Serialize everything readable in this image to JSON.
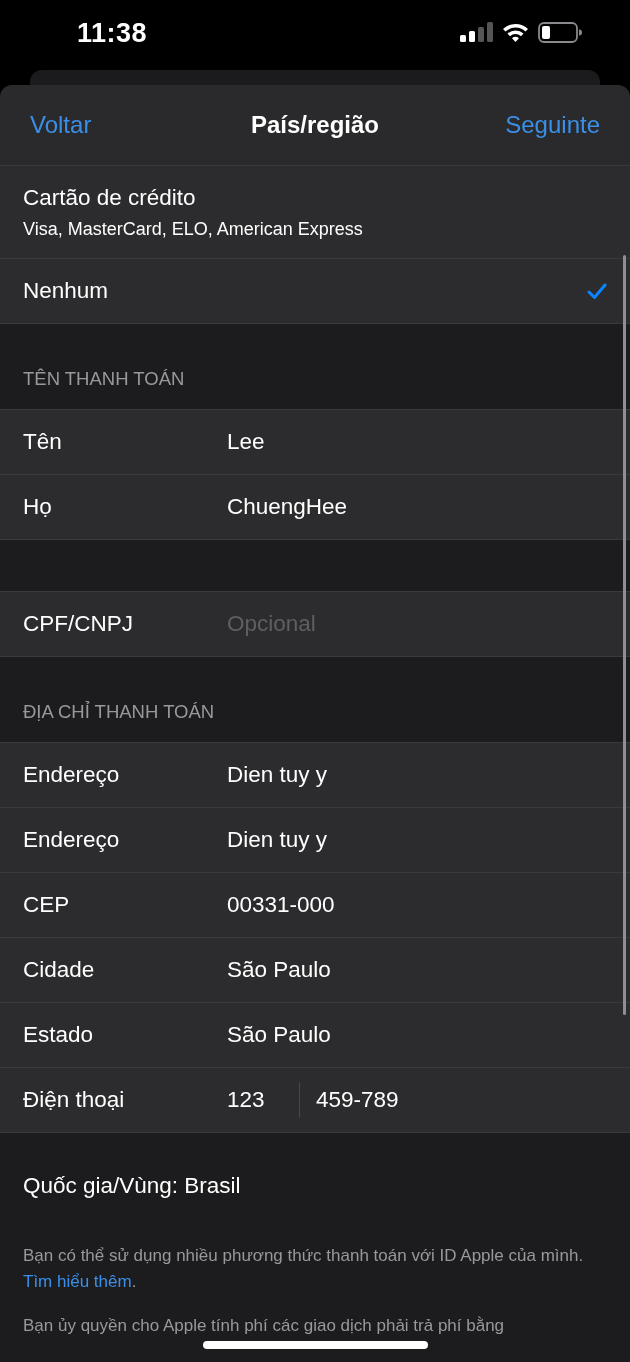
{
  "status_bar": {
    "time": "11:38"
  },
  "nav": {
    "back": "Voltar",
    "title": "País/região",
    "next": "Seguinte"
  },
  "payment_methods": [
    {
      "title": "Cartão de crédito",
      "subtitle": "Visa, MasterCard, ELO, American Express",
      "selected": false
    },
    {
      "title": "Nenhum",
      "selected": true
    }
  ],
  "sections": [
    {
      "header": "TÊN THANH TOÁN",
      "fields": [
        {
          "kind": "text",
          "label": "Tên",
          "value": "Lee"
        },
        {
          "kind": "text",
          "label": "Họ",
          "value": "ChuengHee"
        }
      ]
    },
    {
      "fields": [
        {
          "kind": "text",
          "label": "CPF/CNPJ",
          "placeholder": "Opcional"
        }
      ]
    },
    {
      "header": "ĐỊA CHỈ THANH TOÁN",
      "fields": [
        {
          "kind": "text",
          "label": "Endereço",
          "value": "Dien tuy y"
        },
        {
          "kind": "text",
          "label": "Endereço",
          "value": "Dien tuy y"
        },
        {
          "kind": "text",
          "label": "CEP",
          "value": "00331-000"
        },
        {
          "kind": "text",
          "label": "Cidade",
          "value": "São Paulo"
        },
        {
          "kind": "text",
          "label": "Estado",
          "value": "São Paulo"
        },
        {
          "kind": "phone",
          "label": "Điện thoại",
          "area_code": "123",
          "number": "459-789"
        }
      ]
    }
  ],
  "footer": {
    "country": "Quốc gia/Vùng: Brasil",
    "notes": [
      {
        "text": "Bạn có thể sử dụng nhiều phương thức thanh toán với ID Apple của mình. ",
        "link": "Tìm hiểu thêm",
        "end": "."
      },
      {
        "text": "Bạn ủy quyền cho Apple tính phí các giao dịch phải trả phí bằng"
      }
    ]
  }
}
